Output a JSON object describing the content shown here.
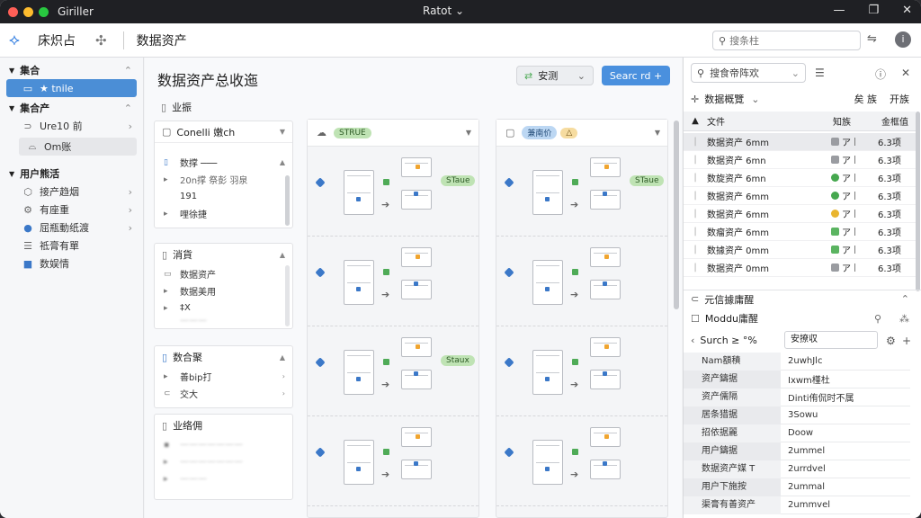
{
  "window": {
    "app_name": "Giriller",
    "title": "Ratot",
    "title_caret": "⌄",
    "controls": [
      "—",
      "❐",
      "✕"
    ]
  },
  "toolbar": {
    "title": "床炽占",
    "page": "数据资产",
    "search_placeholder": "搜条柱",
    "icon_gear": "⚙",
    "icon_book": "⇋",
    "avatar": "i"
  },
  "sidebar": {
    "sections": [
      {
        "label": "集合",
        "items": [
          {
            "label": "★ tnile"
          }
        ]
      },
      {
        "label": "集合产",
        "items": [
          {
            "label": "Ure10 前"
          },
          {
            "label": "Om账"
          }
        ]
      },
      {
        "label": "用户熊活",
        "items": [
          {
            "label": "接产趋烟"
          },
          {
            "label": "有座重"
          },
          {
            "label": "屈瓶動纸渡"
          },
          {
            "label": "祗膏有單"
          },
          {
            "label": "数娱情"
          }
        ]
      }
    ]
  },
  "main": {
    "title": "数据资产总收迤",
    "btn_grey": "安测",
    "btn_blue": "Searc rd +",
    "biz_label": "业振",
    "left_cards": [
      {
        "header": "Conelli 嫩ch",
        "rows": [
          "数撑 ───",
          "20n撑 祭彭 羽泉",
          "191",
          "哩徐捷"
        ]
      },
      {
        "header": "消貨",
        "rows": [
          "数据资产",
          "数据美用",
          "‡X",
          "———"
        ]
      },
      {
        "header": "数合聚",
        "rows": [
          "善bip打",
          "交大"
        ]
      },
      {
        "header": "业络佣",
        "rows": [
          "———————",
          "———————",
          "———"
        ]
      }
    ],
    "col1": {
      "pill": "STRUE",
      "tags": [
        "STaue",
        "Staux"
      ]
    },
    "col2": {
      "pills": [
        "兼南价",
        "△"
      ],
      "tags": [
        "STaue"
      ]
    }
  },
  "right": {
    "search_value": "搜食帝阵欢",
    "section1": "数据概覽",
    "sort1": "矣 族",
    "sort2": "开族",
    "thead": {
      "name": "文件",
      "c2": "知族",
      "c3": "金框值"
    },
    "rows": [
      {
        "name": "数据资产 6mm",
        "status": "gr",
        "mark": "ア",
        "val": "6.3项"
      },
      {
        "name": "数据资产 6mn",
        "status": "gr",
        "mark": "ア",
        "val": "6.3项"
      },
      {
        "name": "数旋资产 6mn",
        "status": "g",
        "mark": "ア",
        "val": "6.3项"
      },
      {
        "name": "数据资产 6mm",
        "status": "g",
        "mark": "ア",
        "val": "6.3项"
      },
      {
        "name": "数据资产 6mm",
        "status": "y",
        "mark": "ア",
        "val": "6.3项"
      },
      {
        "name": "数瘤资产 6mm",
        "status": "gs",
        "mark": "ア",
        "val": "6.3项"
      },
      {
        "name": "数據资产 0mm",
        "status": "gs",
        "mark": "ア",
        "val": "6.3项"
      },
      {
        "name": "数据资产 0mm",
        "status": "gr",
        "mark": "ア",
        "val": "6.3项"
      }
    ],
    "section2": "元信據庸醒",
    "section3": "Moddu庸醒",
    "prop_search_label": "Surch ≥ °%",
    "prop_input": "安撩収",
    "props": [
      {
        "k": "Nam額積",
        "v": "2uwhJlc"
      },
      {
        "k": "资产鑄据",
        "v": "Ixwm槿杜"
      },
      {
        "k": "资产儒隔",
        "v": "Dinti侑侃时不属"
      },
      {
        "k": "居条猎据",
        "v": "3Sowu"
      },
      {
        "k": "招依据麗",
        "v": "Doow"
      },
      {
        "k": "用户鑄据",
        "v": "2ummel"
      },
      {
        "k": "数据资产媒 T",
        "v": "2urrdvel"
      },
      {
        "k": "用户下施按",
        "v": "2ummal"
      },
      {
        "k": "渠膏有善资产",
        "v": "2ummvel"
      }
    ]
  }
}
